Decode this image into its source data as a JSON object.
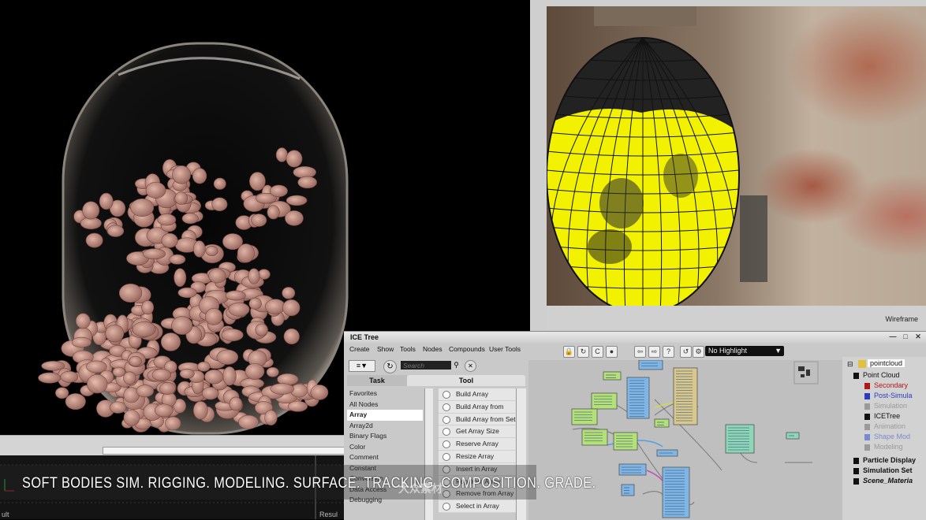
{
  "left_viewport": {
    "status_label": "ult",
    "right_status_label": "Resul"
  },
  "right_viewport": {
    "mode_label": "Wireframe"
  },
  "ice_tree": {
    "title": "ICE Tree",
    "menu": [
      "Create",
      "Show",
      "Tools",
      "Nodes",
      "Compounds",
      "User Tools"
    ],
    "search_placeholder": "Search",
    "highlight_select": "No Highlight",
    "tabs": {
      "task": "Task",
      "tool": "Tool"
    },
    "categories": [
      "Favorites",
      "All Nodes",
      "Array",
      "Array2d",
      "Binary Flags",
      "Color",
      "Comment",
      "Constant",
      "Conversion",
      "Data Access",
      "Debugging"
    ],
    "selected_category": "Array",
    "nodes": [
      "Build Array",
      "Build Array from C...",
      "Build Array from Set",
      "Get Array Size",
      "Reserve Array",
      "Resize Array",
      "Insert in Array",
      "Pop from Array",
      "Remove from Array",
      "Select in Array"
    ],
    "explorer": {
      "root": "pointcloud",
      "items": [
        {
          "label": "Point Cloud",
          "color": "#111111"
        },
        {
          "label": "Secondary",
          "color": "#b01818"
        },
        {
          "label": "Post-Simula",
          "color": "#2a3cc0"
        },
        {
          "label": "Simulation",
          "color": "#9a9a9a"
        },
        {
          "label": "ICETree",
          "color": "#111111"
        },
        {
          "label": "Animation",
          "color": "#9a9a9a"
        },
        {
          "label": "Shape Mod",
          "color": "#7a8ad0"
        },
        {
          "label": "Modeling",
          "color": "#9a9a9a"
        },
        {
          "label": "Particle Display",
          "color": "#111111"
        },
        {
          "label": "Simulation Set",
          "color": "#111111"
        },
        {
          "label": "Scene_Materia",
          "color": "#111111"
        }
      ]
    }
  },
  "caption": "SOFT BODIES SIM. RIGGING. MODELING. SURFACE. TRACKING. COMPOSITION. GRADE.",
  "watermark": "大众素材",
  "colors": {
    "node_green": "#b4e07a",
    "node_blue": "#7fb6e6",
    "node_yellow": "#d8c890",
    "node_teal": "#8ed6b8",
    "wire_yellow": "#f2f200"
  }
}
